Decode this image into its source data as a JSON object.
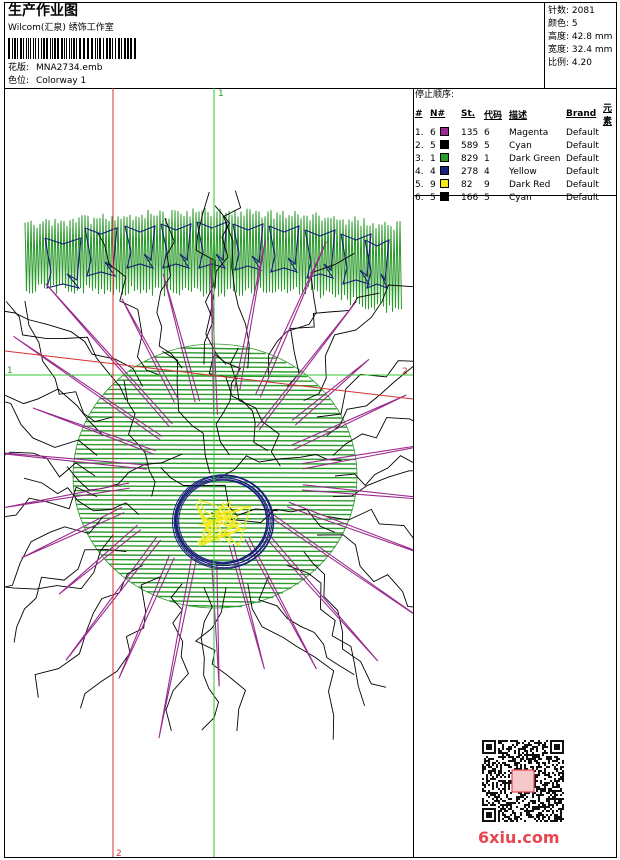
{
  "header": {
    "title": "生产作业图",
    "studio": "Wilcom(汇泉) 绣饰工作室",
    "file_label": "花版:",
    "file_value": "MNA2734.emb",
    "colorway_label": "色位:",
    "colorway_value": "Colorway 1"
  },
  "stats": [
    {
      "label": "针数:",
      "value": "2081"
    },
    {
      "label": "颜色:",
      "value": "5"
    },
    {
      "label": "高度:",
      "value": "42.8 mm"
    },
    {
      "label": "宽度:",
      "value": "32.4 mm"
    },
    {
      "label": "比例:",
      "value": "4.20"
    }
  ],
  "stop_sequence": {
    "title": "停止顺序:",
    "headers": [
      "#",
      "N#",
      "St.",
      "代码",
      "描述",
      "Brand",
      "元素"
    ],
    "rows": [
      {
        "idx": "1.",
        "n": "6",
        "color": "#9a2a8e",
        "st": "135",
        "code": "6",
        "desc": "Magenta",
        "brand": "Default"
      },
      {
        "idx": "2.",
        "n": "5",
        "color": "#000000",
        "st": "589",
        "code": "5",
        "desc": "Cyan",
        "brand": "Default"
      },
      {
        "idx": "3.",
        "n": "1",
        "color": "#2a9a2a",
        "st": "829",
        "code": "1",
        "desc": "Dark Green",
        "brand": "Default"
      },
      {
        "idx": "4.",
        "n": "4",
        "color": "#1a1f7a",
        "st": "278",
        "code": "4",
        "desc": "Yellow",
        "brand": "Default"
      },
      {
        "idx": "5.",
        "n": "9",
        "color": "#f2ea1a",
        "st": "82",
        "code": "9",
        "desc": "Dark Red",
        "brand": "Default"
      },
      {
        "idx": "6.",
        "n": "5",
        "color": "#000000",
        "st": "166",
        "code": "5",
        "desc": "Cyan",
        "brand": "Default"
      }
    ]
  },
  "axes": {
    "green_top": "1",
    "green_left": "1",
    "red_right": "2",
    "red_bottom": "2"
  },
  "watermark": {
    "brand": "6xiu.com"
  },
  "colors": {
    "magenta": "#9a2a8e",
    "green": "#2a9a2a",
    "navy": "#1a1f7a",
    "yellow": "#f2ea1a",
    "guide_green": "#35c435",
    "guide_red": "#d43030"
  }
}
